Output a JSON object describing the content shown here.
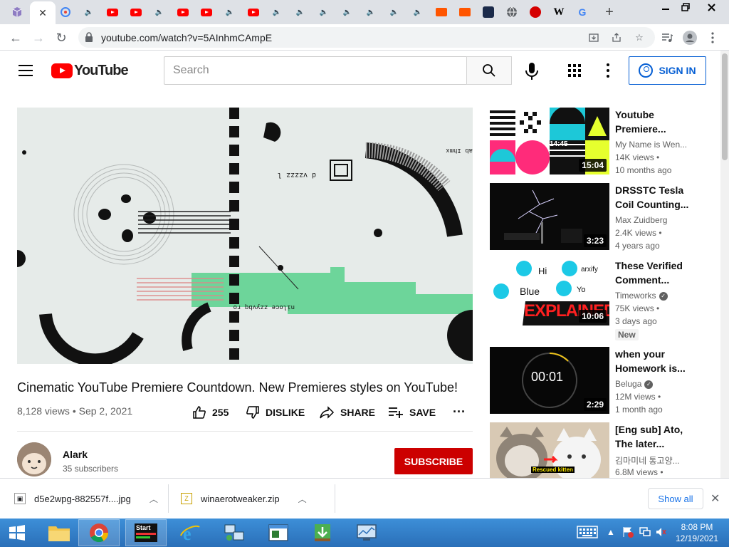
{
  "browser": {
    "url": "youtube.com/watch?v=5AInhmCAmpE",
    "tabs": [
      {
        "icon": "cube-icon"
      },
      {
        "icon": "youtube-icon",
        "active": true
      },
      {
        "icon": "google-lens-icon"
      },
      {
        "icon": "speaker-icon"
      },
      {
        "icon": "youtube-icon"
      },
      {
        "icon": "youtube-icon"
      },
      {
        "icon": "speaker-icon"
      },
      {
        "icon": "youtube-icon"
      },
      {
        "icon": "youtube-icon"
      },
      {
        "icon": "speaker-icon"
      },
      {
        "icon": "youtube-icon"
      },
      {
        "icon": "speaker-icon"
      },
      {
        "icon": "speaker-icon"
      },
      {
        "icon": "speaker-icon"
      },
      {
        "icon": "speaker-icon"
      },
      {
        "icon": "speaker-icon"
      },
      {
        "icon": "speaker-icon"
      },
      {
        "icon": "speaker-icon"
      },
      {
        "icon": "soundcloud-icon"
      },
      {
        "icon": "soundcloud-icon"
      },
      {
        "icon": "site-icon"
      },
      {
        "icon": "globe-icon"
      },
      {
        "icon": "red-icon"
      },
      {
        "icon": "wikipedia-icon"
      },
      {
        "icon": "google-icon"
      }
    ],
    "wiki_letter": "W",
    "google_letter": "G",
    "colors": {
      "tabstrip": "#dee1e6",
      "accent": "#1a73e8"
    }
  },
  "youtube": {
    "logo_text": "YouTube",
    "search_placeholder": "Search",
    "signin_label": "SIGN IN",
    "video": {
      "title": "Cinematic YouTube Premiere Countdown. New Premieres styles on YouTube!",
      "views": "8,128 views",
      "date": "Sep 2, 2021",
      "likes": "255",
      "dislike_label": "DISLIKE",
      "share_label": "SHARE",
      "save_label": "SAVE"
    },
    "channel": {
      "name": "Alark",
      "subscribers": "35 subscribers",
      "subscribe_label": "SUBSCRIBE"
    },
    "recommendations": [
      {
        "title": "Youtube Premiere...",
        "channel": "My Name is Wen...",
        "views": "14K views •",
        "age": "10 months ago",
        "duration": "15:04",
        "verified": false
      },
      {
        "title": "DRSSTC Tesla Coil Counting...",
        "channel": "Max Zuidberg",
        "views": "2.4K views •",
        "age": "4 years ago",
        "duration": "3:23",
        "verified": false
      },
      {
        "title": "These Verified Comment...",
        "channel": "Timeworks",
        "views": "75K views •",
        "age": "3 days ago",
        "duration": "10:06",
        "verified": true,
        "badge": "New"
      },
      {
        "title": "when your Homework is...",
        "channel": "Beluga",
        "views": "12M views •",
        "age": "1 month ago",
        "duration": "2:29",
        "verified": true
      },
      {
        "title": "[Eng sub] Ato, The later...",
        "channel": "김마미네 통고양...",
        "views": "6.8M views •",
        "age": "",
        "duration": "",
        "verified": false
      }
    ],
    "thumb_text": {
      "t1_time": "14:45",
      "t3_hi": "Hi",
      "t3_arxify": "arxify",
      "t3_blue": "Blue",
      "t3_yo": "Yo",
      "t3_explained": "EXPLAINED!",
      "t4_clock": "00:01",
      "t5_caption": "Rescued kitten"
    },
    "colors": {
      "brand_red": "#ff0000",
      "subscribe": "#cc0000",
      "link_blue": "#065fd4"
    }
  },
  "downloads": {
    "items": [
      {
        "name": "d5e2wpg-882557f....jpg"
      },
      {
        "name": "winaerotweaker.zip"
      }
    ],
    "show_all_label": "Show all"
  },
  "taskbar": {
    "start_label": "Start",
    "time": "8:08 PM",
    "date": "12/19/2021"
  }
}
